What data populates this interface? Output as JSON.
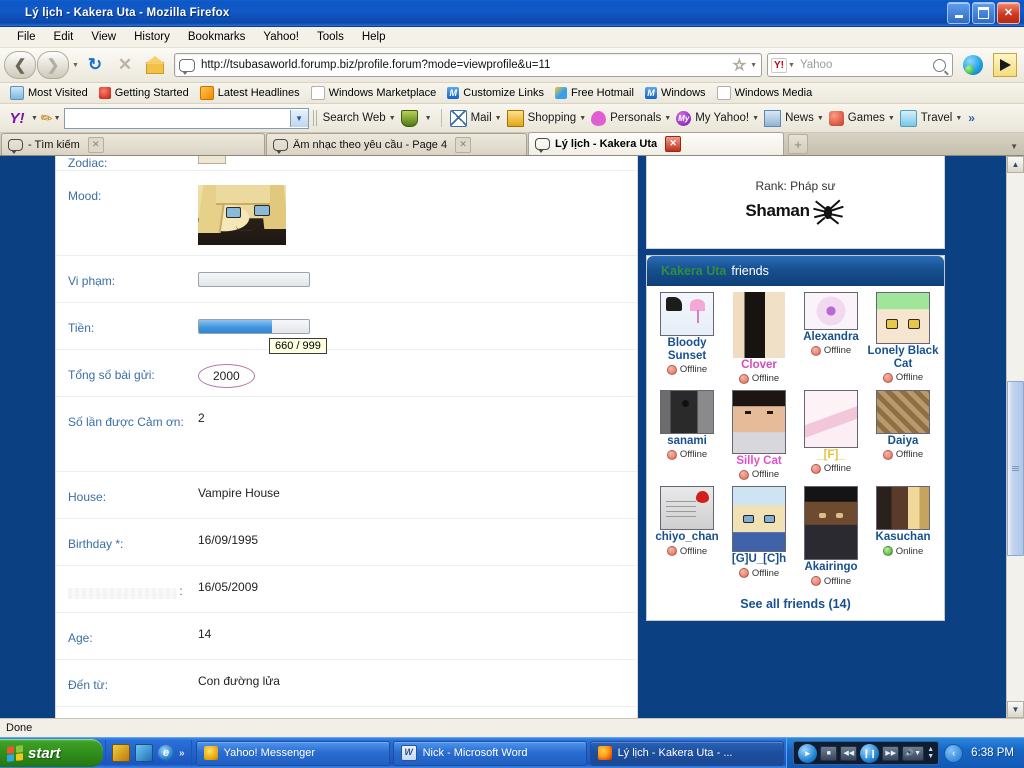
{
  "window": {
    "title": "Lý lịch - Kakera Uta - Mozilla Firefox",
    "minimize_label": "Minimize",
    "maximize_label": "Maximize",
    "close_label": "Close"
  },
  "menu": {
    "items": [
      "File",
      "Edit",
      "View",
      "History",
      "Bookmarks",
      "Yahoo!",
      "Tools",
      "Help"
    ]
  },
  "navbar": {
    "back_label": "Back",
    "forward_label": "Forward",
    "reload_label": "Reload",
    "stop_label": "Stop",
    "home_label": "Home",
    "url": "http://tsubasaworld.forump.biz/profile.forum?mode=viewprofile&u=11",
    "bookmark_star": "☆",
    "search_placeholder": "Yahoo",
    "search_value": ""
  },
  "bookmarks": {
    "items": [
      {
        "label": "Most Visited",
        "icon": "globe-icon"
      },
      {
        "label": "Getting Started",
        "icon": "firefox-icon"
      },
      {
        "label": "Latest Headlines",
        "icon": "rss-icon"
      },
      {
        "label": "Windows Marketplace",
        "icon": "page-icon"
      },
      {
        "label": "Customize Links",
        "icon": "msn-icon"
      },
      {
        "label": "Free Hotmail",
        "icon": "windows-icon"
      },
      {
        "label": "Windows",
        "icon": "msn-icon"
      },
      {
        "label": "Windows Media",
        "icon": "page-icon"
      }
    ]
  },
  "yahoo_toolbar": {
    "logo": "Y!",
    "search_value": "",
    "search_button": "Search Web",
    "items": [
      {
        "label": "Mail",
        "icon": "mail-icon"
      },
      {
        "label": "Shopping",
        "icon": "bag-icon"
      },
      {
        "label": "Personals",
        "icon": "heart-icon"
      },
      {
        "label": "My Yahoo!",
        "icon": "my-icon"
      },
      {
        "label": "News",
        "icon": "news-icon"
      },
      {
        "label": "Games",
        "icon": "games-icon"
      },
      {
        "label": "Travel",
        "icon": "travel-icon"
      }
    ],
    "overflow": "»"
  },
  "tabs": [
    {
      "label": "- Tìm kiếm",
      "active": false
    },
    {
      "label": "Âm nhạc theo yêu cầu - Page 4",
      "active": false
    },
    {
      "label": "Lý lịch - Kakera Uta",
      "active": true
    }
  ],
  "new_tab_label": "+",
  "profile": {
    "rows": [
      {
        "label": "Zodiac:",
        "value": "",
        "type": "image-cut"
      },
      {
        "label": "Mood:",
        "value": "",
        "type": "mood-image"
      },
      {
        "label": "Vi phạm:",
        "value": "",
        "type": "bar",
        "percent": 0
      },
      {
        "label": "Tiền:",
        "value": "",
        "type": "bar",
        "percent": 66,
        "tooltip": "660 / 999"
      },
      {
        "label": "Tổng số bài gửi:",
        "value": "2000",
        "type": "ellipse"
      },
      {
        "label": "Số lần được Cảm ơn:",
        "value": "2",
        "type": "text"
      },
      {
        "label": "House:",
        "value": "Vampire House",
        "type": "text"
      },
      {
        "label": "Birthday *:",
        "value": "16/09/1995",
        "type": "text"
      },
      {
        "label": "",
        "value": "16/05/2009",
        "type": "obscured"
      },
      {
        "label": "Age:",
        "value": "14",
        "type": "text"
      },
      {
        "label": "Đến từ:",
        "value": "Con đường lửa",
        "type": "text"
      }
    ]
  },
  "sidebar": {
    "rank_label": "Rank: Pháp sư",
    "rank_badge": "Shaman",
    "friends_owner": "Kakera Uta",
    "friends_title": "friends",
    "see_all": "See all friends (14)",
    "friends": [
      {
        "name": "Bloody Sunset",
        "status": "Offline",
        "color": "#17508f"
      },
      {
        "name": "Clover",
        "status": "Offline",
        "color": "#d44ac0"
      },
      {
        "name": "Alexandra",
        "status": "Offline",
        "color": "#17508f"
      },
      {
        "name": "Lonely Black Cat",
        "status": "Offline",
        "color": "#17508f"
      },
      {
        "name": "sanami",
        "status": "Offline",
        "color": "#17508f"
      },
      {
        "name": "Silly Cat",
        "status": "Offline",
        "color": "#e24fcb"
      },
      {
        "name": "_[F]_",
        "status": "Offline",
        "color": "#e3c23a"
      },
      {
        "name": "Daiya",
        "status": "Offline",
        "color": "#17508f"
      },
      {
        "name": "chiyo_chan",
        "status": "Offline",
        "color": "#17508f"
      },
      {
        "name": "[G]U_[C]h",
        "status": "Offline",
        "color": "#17508f"
      },
      {
        "name": "Akairingo",
        "status": "Offline",
        "color": "#17508f"
      },
      {
        "name": "Kasuchan",
        "status": "Online",
        "color": "#17508f"
      }
    ]
  },
  "status_bar": {
    "text": "Done"
  },
  "taskbar": {
    "start_label": "start",
    "tasks": [
      {
        "label": "Yahoo! Messenger",
        "icon": "yahoo-messenger-icon",
        "active": false
      },
      {
        "label": "Nick - Microsoft Word",
        "icon": "word-icon",
        "active": false
      },
      {
        "label": "Lý lịch - Kakera Uta - ...",
        "icon": "firefox-icon",
        "active": true
      }
    ],
    "quick_launch_overflow": "»",
    "clock": "6:38 PM",
    "tray_expand": "‹"
  },
  "scrollbar": {
    "up": "▲",
    "down": "▼"
  },
  "colors": {
    "title_blue": "#0e57c3",
    "page_bg": "#0b4182",
    "link_blue": "#3a6ea5",
    "header_blue": "#17508f",
    "progress_blue": "#3d94dd",
    "online_green": "#3fa62b",
    "offline_red": "#e06a55"
  }
}
